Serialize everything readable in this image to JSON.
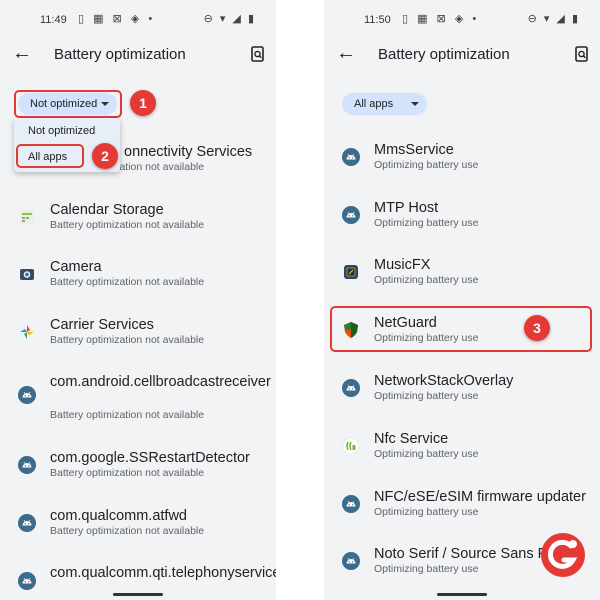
{
  "left": {
    "status": {
      "time": "11:49",
      "notif": "▯ ▦ ⊠ ◈ •",
      "right": "⊖ ▾ ◢ ▮"
    },
    "appbar": {
      "title": "Battery optimization"
    },
    "filter_chip": "Not optimized",
    "dropdown": {
      "options": [
        "Not optimized",
        "All apps"
      ]
    },
    "badges": [
      "1",
      "2"
    ],
    "apps": [
      {
        "name": "onnectivity Services",
        "status": "Battery optimization not available"
      },
      {
        "name": "Calendar Storage",
        "status": "Battery optimization not available"
      },
      {
        "name": "Camera",
        "status": "Battery optimization not available"
      },
      {
        "name": "Carrier Services",
        "status": "Battery optimization not available"
      },
      {
        "name": "com.android.cellbroadcastreceiver",
        "status": "Battery optimization not available"
      },
      {
        "name": "com.google.SSRestartDetector",
        "status": "Battery optimization not available"
      },
      {
        "name": "com.qualcomm.atfwd",
        "status": "Battery optimization not available"
      },
      {
        "name": "com.qualcomm.qti.telephonyservice",
        "status": ""
      }
    ]
  },
  "right": {
    "status": {
      "time": "11:50",
      "notif": "▯ ▦ ⊠ ◈ •",
      "right": "⊖ ▾ ◢ ▮"
    },
    "appbar": {
      "title": "Battery optimization"
    },
    "filter_chip": "All apps",
    "badges": [
      "3"
    ],
    "apps": [
      {
        "name": "MmsService",
        "status": "Optimizing battery use"
      },
      {
        "name": "MTP Host",
        "status": "Optimizing battery use"
      },
      {
        "name": "MusicFX",
        "status": "Optimizing battery use"
      },
      {
        "name": "NetGuard",
        "status": "Optimizing battery use"
      },
      {
        "name": "NetworkStackOverlay",
        "status": "Optimizing battery use"
      },
      {
        "name": "Nfc Service",
        "status": "Optimizing battery use"
      },
      {
        "name": "NFC/eSE/eSIM firmware updater",
        "status": "Optimizing battery use"
      },
      {
        "name": "Noto Serif / Source Sans Pro",
        "status": "Optimizing battery use"
      }
    ]
  },
  "colors": {
    "accent_chip": "#d3e3fd",
    "highlight": "#e53935",
    "android_icon": "#3c6e8f"
  }
}
